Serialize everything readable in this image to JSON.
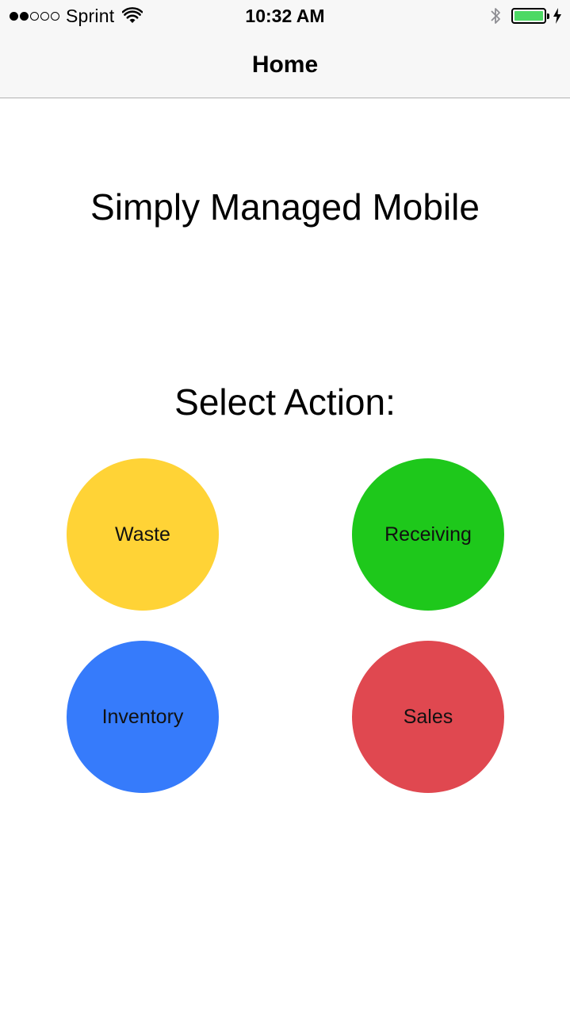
{
  "status_bar": {
    "carrier": "Sprint",
    "signal_bars": 2,
    "signal_total": 5,
    "time": "10:32 AM",
    "battery_level": 1.0,
    "battery_color": "#4cd964",
    "icons": [
      "signal-dots-icon",
      "wifi-icon",
      "bluetooth-icon",
      "battery-icon",
      "charging-bolt-icon"
    ]
  },
  "nav": {
    "title": "Home"
  },
  "content": {
    "app_title": "Simply Managed Mobile",
    "section_title": "Select Action:"
  },
  "actions": [
    {
      "label": "Waste",
      "color": "#ffd336"
    },
    {
      "label": "Receiving",
      "color": "#1ec81b"
    },
    {
      "label": "Inventory",
      "color": "#367bfb"
    },
    {
      "label": "Sales",
      "color": "#e04850"
    }
  ]
}
